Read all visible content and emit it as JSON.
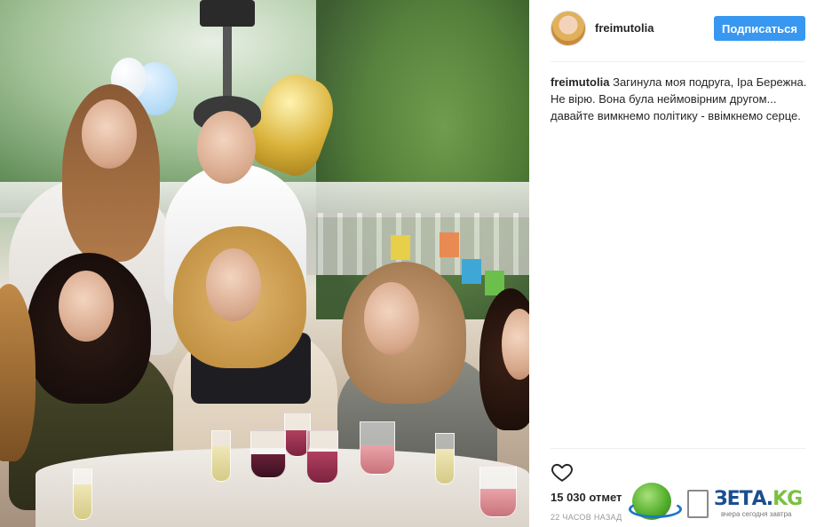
{
  "post": {
    "username": "freimutolia",
    "follow_label": "Подписаться",
    "caption_username": "freimutolia",
    "caption_text": "Загинула моя подруга, Іра Бережна. Не вірю. Вона була неймовірним другом... давайте вимкнемо політику - ввімкнемо серце.",
    "likes": "15 030 отмет",
    "timestamp": "22 ЧАСОВ НАЗАД"
  },
  "icons": {
    "like": "heart-icon",
    "avatar": "avatar"
  },
  "watermark": {
    "brand": "ЗЕТА.",
    "brand_suffix": "KG",
    "tagline": "вчера сегодня завтра"
  },
  "colors": {
    "follow_button": "#3897f0",
    "text": "#262626",
    "muted": "#999999"
  }
}
